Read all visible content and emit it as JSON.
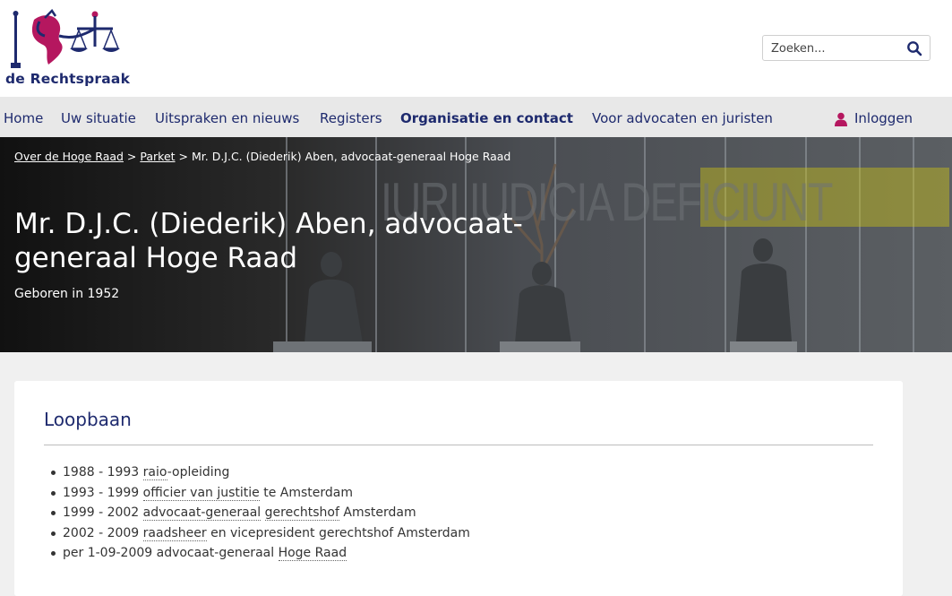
{
  "header": {
    "logo_text": "de Rechtspraak",
    "search_placeholder": "Zoeken..."
  },
  "nav": {
    "items": [
      "Home",
      "Uw situatie",
      "Uitspraken en nieuws",
      "Registers",
      "Organisatie en contact",
      "Voor advocaten en juristen"
    ],
    "active": "Organisatie en contact",
    "login": "Inloggen"
  },
  "hero": {
    "breadcrumb": {
      "item1": "Over de Hoge Raad",
      "sep1": " > ",
      "item2": "Parket",
      "sep2": " > ",
      "current": "Mr. D.J.C. (Diederik) Aben, advocaat-generaal Hoge Raad"
    },
    "title": "Mr. D.J.C. (Diederik) Aben, advocaat-generaal Hoge Raad",
    "subtitle": "Geboren in 1952",
    "wall_text": "IURI IUDICIA DEFICIUNT"
  },
  "loopbaan": {
    "title": "Loopbaan",
    "items": [
      {
        "period": "1988 - 1993 ",
        "term": "raio",
        "rest": "-opleiding"
      },
      {
        "period": "1993 - 1999 ",
        "term": "officier van justitie",
        "rest": " te Amsterdam"
      },
      {
        "period": "1999 - 2002 ",
        "term": "advocaat-generaal",
        "mid": " ",
        "term2": "gerechtshof",
        "rest": " Amsterdam"
      },
      {
        "period": "2002 - 2009 ",
        "term": "raadsheer",
        "rest": " en vicepresident gerechtshof Amsterdam"
      },
      {
        "period": "per 1-09-2009 advocaat-generaal ",
        "term": "Hoge Raad",
        "rest": ""
      }
    ]
  },
  "colors": {
    "brand_blue": "#1e2a6e",
    "brand_magenta": "#b5175f",
    "nav_bg": "#e8e8e8",
    "page_bg": "#f0f0f0"
  }
}
